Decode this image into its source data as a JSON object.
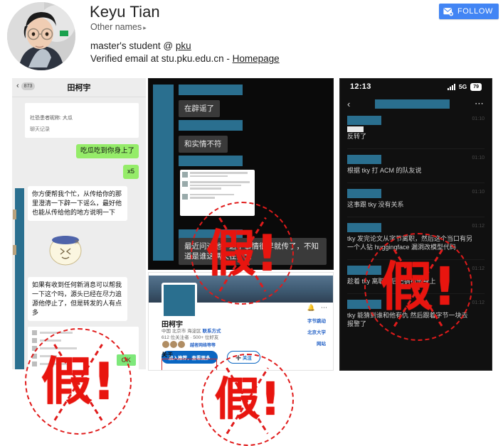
{
  "profile": {
    "name": "Keyu Tian",
    "other_names_label": "Other names",
    "other_names_caret": "▸",
    "affiliation": "master's student @ ",
    "affiliation_link": "pku",
    "verified_prefix": "Verified email at stu.pku.edu.cn - ",
    "homepage_link": "Homepage",
    "follow_label": "FOLLOW",
    "follow_icon": "envelope-plus-icon",
    "accent_blue": "#4285f4"
  },
  "collage": {
    "stamp_text": "假!",
    "stamp_color": "#e8150f",
    "redaction_color": "#2a6f8f",
    "panel_left": {
      "app": "wechat-chat-light",
      "back_badge": "873",
      "title": "田柯宇",
      "card_line1": "社恐患者昵称: 大瓜",
      "card_line2": "聊天记录",
      "bubble_1": "吃瓜吃到你身上了",
      "bubble_2": "x5",
      "bubble_3": "你方便帮我个忙，从传给你的那里澄清一下辟一下谣么，最好他也能从传给他的地方说明一下",
      "bubble_4": "如果有收到任何新消息可以帮我一下这个吗，源头已经在尽力追源他停止了，但是转发的人有点多",
      "ok_bubble": "OK",
      "sticker": "cat-sticker"
    },
    "panel_mid_top": {
      "app": "chat-dark",
      "bubble_1": "在辟谣了",
      "bubble_2": "和实情不符",
      "bubble_3": "最近问过他，这个事情很早就传了，不知道是谁这俩天在扩大"
    },
    "panel_mid_bottom": {
      "app": "social-profile",
      "name": "田柯宇",
      "meta_line1": "中国 北京市 海淀区",
      "meta_contact": "联系方式",
      "meta_line2": "612 位关注者  ·  500+ 位好友",
      "mutual": "越者网络等等",
      "btn_primary": "加入推荐，查看更多",
      "btn_ghost": "➕ 关注",
      "right_links": [
        "字节跳动",
        "北京大学",
        "网站"
      ],
      "about_label": "关于",
      "bell_icon": "bell-icon",
      "more_icon": "more-dots-icon"
    },
    "panel_right": {
      "app": "chat-dark-phone",
      "status_time": "12:13",
      "network": "5G",
      "battery": "79",
      "signal_icon": "signal-bars-icon",
      "back_icon": "chevron-left-icon",
      "more_icon": "more-dots-icon",
      "messages": [
        {
          "text": "反转了",
          "time": "01:10"
        },
        {
          "text": "根据 tky 打 ACM 的队友说",
          "time": "01:10"
        },
        {
          "text": "这事跟 tky 没有关系",
          "time": "01:10"
        },
        {
          "text": "tky 发完论文从字节离职，然后这个当口有另一个人钻 huggingface 漏洞改模型代码",
          "time": "01:12"
        },
        {
          "text": "趁着 tky 离职然后把锅扣他身上",
          "time": "01:12"
        },
        {
          "text": "tky 能猜到谁和他有仇 然后跟着字节一块去报警了",
          "time": "01:12"
        }
      ]
    }
  }
}
